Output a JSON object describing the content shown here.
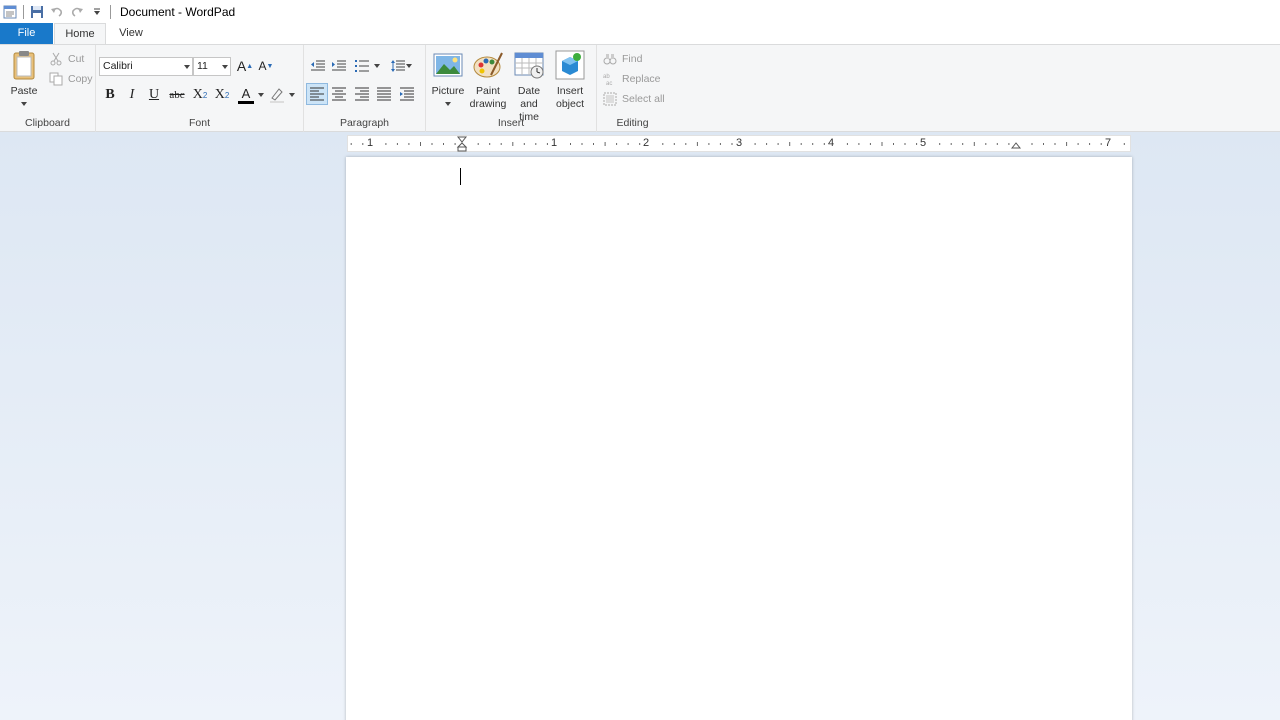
{
  "window": {
    "title": "Document - WordPad"
  },
  "qat": {
    "icons": [
      "wordpad-app-icon",
      "save-icon",
      "undo-icon",
      "redo-icon",
      "customize-qat-icon"
    ]
  },
  "tabs": {
    "file": "File",
    "home": "Home",
    "view": "View"
  },
  "ribbon": {
    "clipboard": {
      "label": "Clipboard",
      "paste": "Paste",
      "cut": "Cut",
      "copy": "Copy"
    },
    "font": {
      "label": "Font",
      "family": "Calibri",
      "size": "11",
      "bold": "B",
      "italic": "I",
      "underline": "U",
      "strike": "abc",
      "sub": "X",
      "sup": "X",
      "sub_mark": "2",
      "sup_mark": "2",
      "grow": "A",
      "shrink": "A",
      "color_letter": "A"
    },
    "paragraph": {
      "label": "Paragraph"
    },
    "insert": {
      "label": "Insert",
      "picture": "Picture",
      "paint_line1": "Paint",
      "paint_line2": "drawing",
      "date_line1": "Date and",
      "date_line2": "time",
      "object_line1": "Insert",
      "object_line2": "object"
    },
    "editing": {
      "label": "Editing",
      "find": "Find",
      "replace": "Replace",
      "select_all": "Select all"
    }
  },
  "ruler": {
    "numbers": [
      "1",
      "1",
      "2",
      "3",
      "4",
      "5",
      "7"
    ]
  },
  "colors": {
    "file_tab": "#1979ca",
    "ribbon_bg": "#f5f6f7",
    "workspace": "#dde7f3"
  }
}
